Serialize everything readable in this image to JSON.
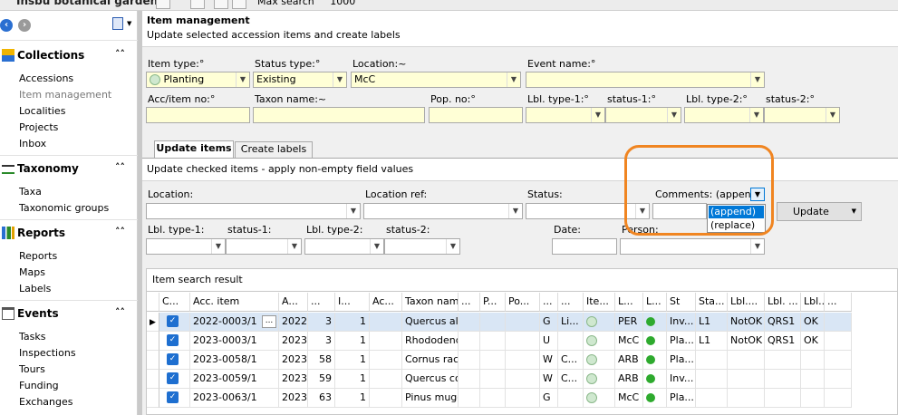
{
  "app_title": "Insbu botanical garden",
  "max_search_label": "Max search",
  "max_search_value": "1000",
  "sidebar": {
    "sections": [
      {
        "title": "Collections",
        "items": [
          "Accessions",
          "Item management",
          "Localities",
          "Projects",
          "Inbox"
        ]
      },
      {
        "title": "Taxonomy",
        "items": [
          "Taxa",
          "Taxonomic groups"
        ]
      },
      {
        "title": "Reports",
        "items": [
          "Reports",
          "Maps",
          "Labels"
        ]
      },
      {
        "title": "Events",
        "items": [
          "Tasks",
          "Inspections",
          "Tours",
          "Funding",
          "Exchanges"
        ]
      }
    ]
  },
  "header": {
    "title": "Item management",
    "subtitle": "Update selected accession items and create labels"
  },
  "filters": {
    "item_type": {
      "label": "Item type:",
      "value": "Planting"
    },
    "status_type": {
      "label": "Status type:",
      "value": "Existing"
    },
    "location": {
      "label": "Location:",
      "value": "McC"
    },
    "event_name": {
      "label": "Event name:",
      "value": ""
    },
    "acc_item_no": {
      "label": "Acc/item no:",
      "value": ""
    },
    "taxon_name": {
      "label": "Taxon name:",
      "value": ""
    },
    "pop_no": {
      "label": "Pop. no:",
      "value": ""
    },
    "lbl_type_1": {
      "label": "Lbl. type-1:",
      "value": ""
    },
    "status_1": {
      "label": "status-1:",
      "value": ""
    },
    "lbl_type_2": {
      "label": "Lbl. type-2:",
      "value": ""
    },
    "status_2": {
      "label": "status-2:",
      "value": ""
    }
  },
  "tabs": [
    "Update items",
    "Create labels"
  ],
  "update_panel": {
    "info": "Update checked items - apply non-empty field values",
    "location_label": "Location:",
    "location_ref_label": "Location ref:",
    "status_label": "Status:",
    "comments_label": "Comments:",
    "comments_mode": "(append)",
    "comments_options": [
      "(append)",
      "(replace)"
    ],
    "update_button": "Update",
    "lbl_type_1_label": "Lbl. type-1:",
    "status_1_label": "status-1:",
    "lbl_type_2_label": "Lbl. type-2:",
    "status_2_label": "status-2:",
    "date_label": "Date:",
    "person_label": "Person:"
  },
  "results": {
    "title": "Item search result",
    "columns": [
      "C...",
      "Acc. item",
      "A...",
      "...",
      "I...",
      "Ac...",
      "Taxon name",
      "...",
      "P...",
      "Po...",
      "...",
      "...",
      "Ite...",
      "L...",
      "L...",
      "St",
      "Sta...",
      "Lbl....",
      "Lbl. ...",
      "Lbl....",
      "...",
      "..."
    ],
    "rows": [
      {
        "acc_item": "2022-0003/1",
        "year": "2022",
        "n1": "3",
        "n2": "1",
        "taxon": "Quercus alba",
        "p": "G",
        "l1": "Li...",
        "loc": "PER",
        "status": "Inv...",
        "lbl1": "L1",
        "lbl2": "NotOK",
        "lbl3": "QRS1",
        "lbl4": "OK"
      },
      {
        "acc_item": "2023-0003/1",
        "year": "2023",
        "n1": "3",
        "n2": "1",
        "taxon": "Rhododendr...",
        "p": "U",
        "l1": "",
        "loc": "McC",
        "status": "Pla...",
        "lbl1": "L1",
        "lbl2": "NotOK",
        "lbl3": "QRS1",
        "lbl4": "OK"
      },
      {
        "acc_item": "2023-0058/1",
        "year": "2023",
        "n1": "58",
        "n2": "1",
        "taxon": "Cornus race...",
        "p": "W",
        "l1": "C...",
        "loc": "ARB",
        "status": "Pla...",
        "lbl1": "",
        "lbl2": "",
        "lbl3": "",
        "lbl4": ""
      },
      {
        "acc_item": "2023-0059/1",
        "year": "2023",
        "n1": "59",
        "n2": "1",
        "taxon": "Quercus coc...",
        "p": "W",
        "l1": "C...",
        "loc": "ARB",
        "status": "Inv...",
        "lbl1": "",
        "lbl2": "",
        "lbl3": "",
        "lbl4": ""
      },
      {
        "acc_item": "2023-0063/1",
        "year": "2023",
        "n1": "63",
        "n2": "1",
        "taxon": "Pinus mugo ...",
        "p": "G",
        "l1": "",
        "loc": "McC",
        "status": "Pla...",
        "lbl1": "",
        "lbl2": "",
        "lbl3": "",
        "lbl4": ""
      }
    ]
  },
  "colors": {
    "accent": "#1e6fd0",
    "highlight": "#f08521",
    "required_bg": "#ffffd6",
    "status_ok": "#2eaa2e"
  }
}
